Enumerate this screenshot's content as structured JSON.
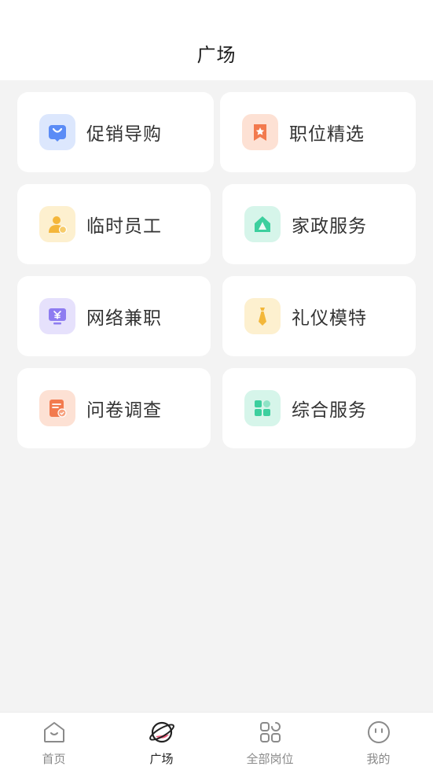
{
  "header": {
    "title": "广场"
  },
  "grid": {
    "items": [
      {
        "label": "促销导购",
        "icon": "shopping-bag-icon",
        "color": "#5b8cf6"
      },
      {
        "label": "职位精选",
        "icon": "star-bookmark-icon",
        "color": "#f27a4e"
      },
      {
        "label": "临时员工",
        "icon": "worker-icon",
        "color": "#f4b63a"
      },
      {
        "label": "家政服务",
        "icon": "house-icon",
        "color": "#3ccf9e"
      },
      {
        "label": "网络兼职",
        "icon": "monitor-yen-icon",
        "color": "#8e7cf1"
      },
      {
        "label": "礼仪模特",
        "icon": "tie-icon",
        "color": "#f3b73a"
      },
      {
        "label": "问卷调查",
        "icon": "survey-icon",
        "color": "#f27a4e"
      },
      {
        "label": "综合服务",
        "icon": "grid-blocks-icon",
        "color": "#3ccf9e"
      }
    ]
  },
  "tabbar": {
    "items": [
      {
        "label": "首页",
        "icon": "home-icon",
        "active": false
      },
      {
        "label": "广场",
        "icon": "planet-icon",
        "active": true
      },
      {
        "label": "全部岗位",
        "icon": "apps-grid-icon",
        "active": false
      },
      {
        "label": "我的",
        "icon": "smiley-icon",
        "active": false
      }
    ]
  }
}
